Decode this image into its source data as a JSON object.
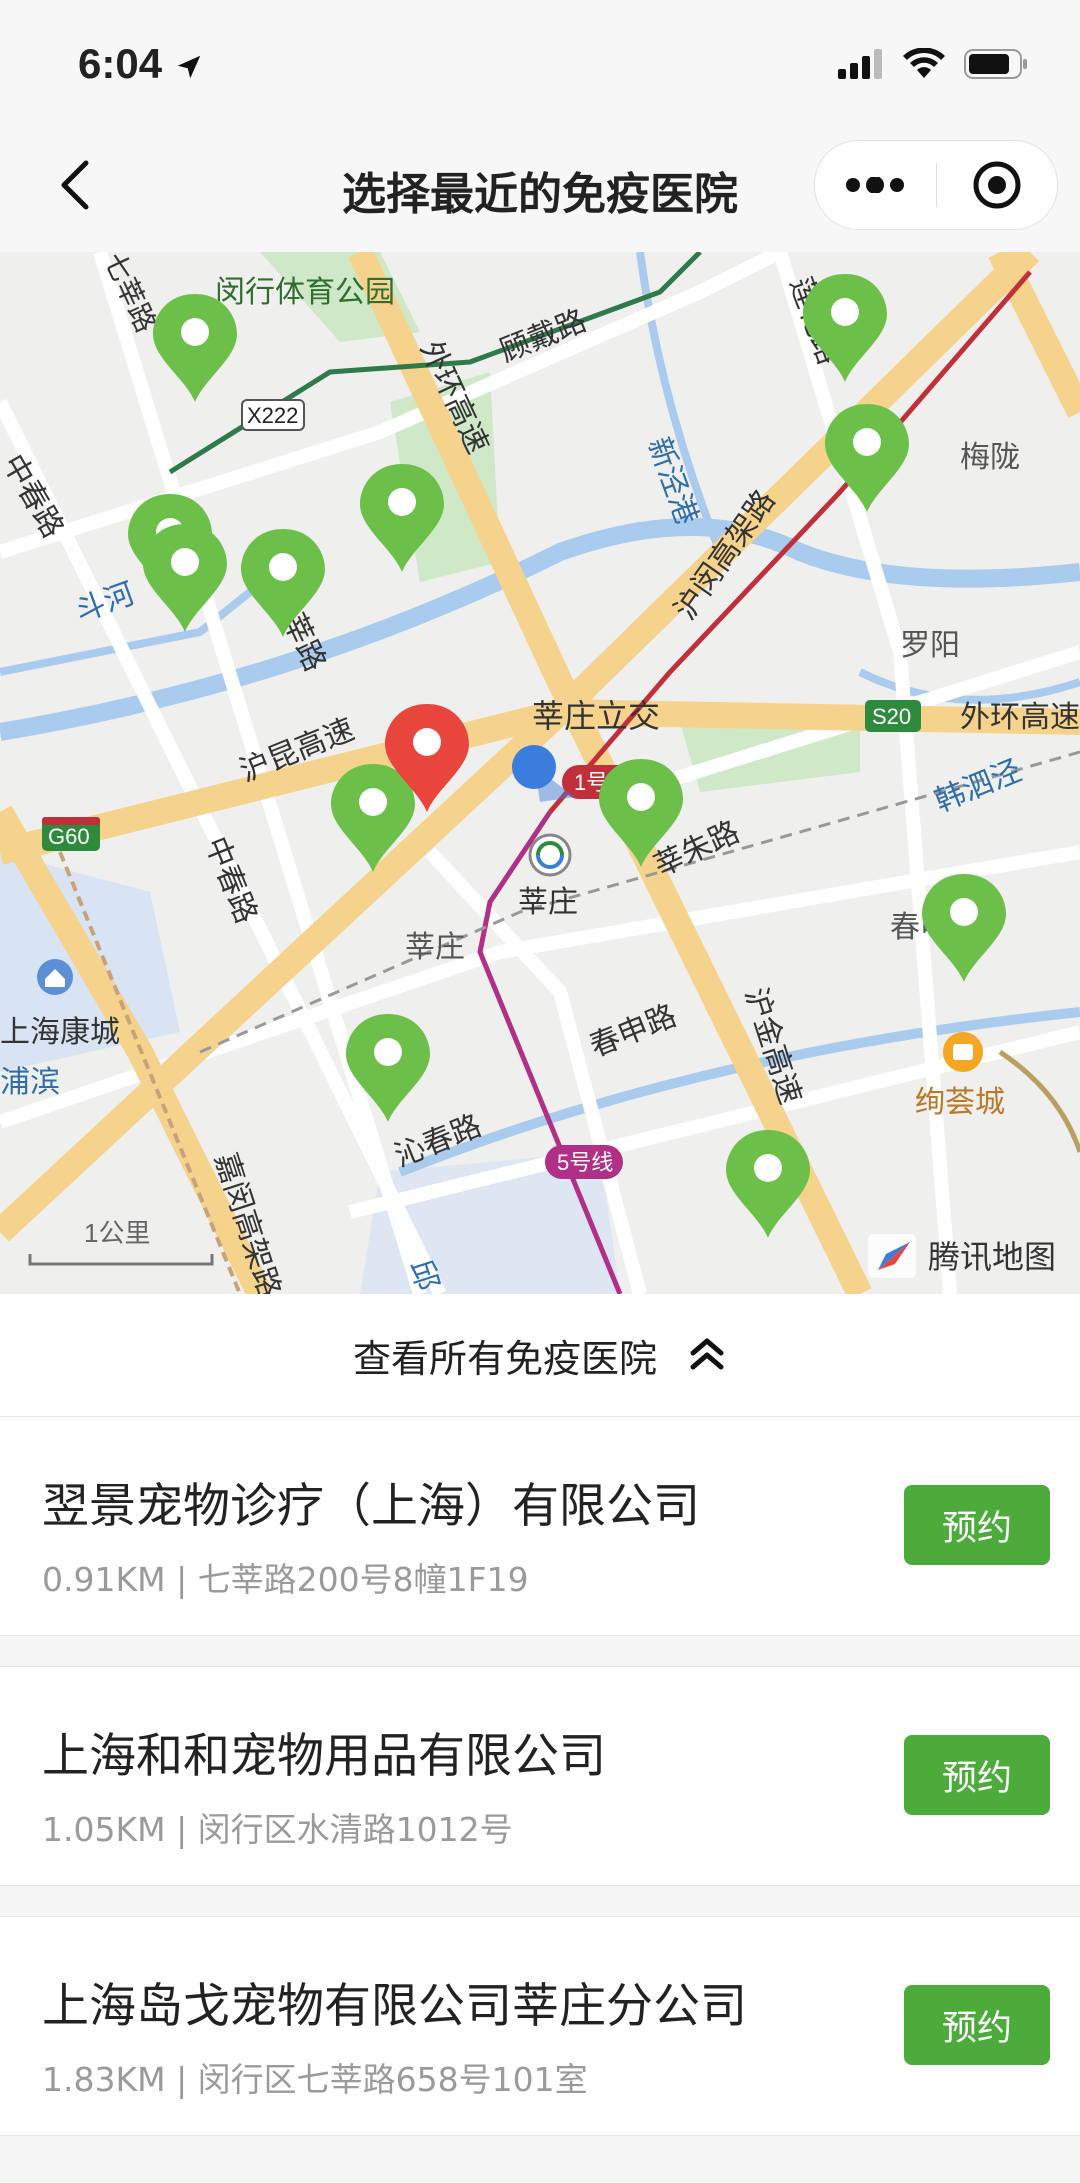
{
  "status": {
    "time": "6:04"
  },
  "nav": {
    "title": "选择最近的免疫医院"
  },
  "map": {
    "labels": {
      "park": "闵行体育公园",
      "qixin_road_n": "七莘路",
      "x222": "X222",
      "gudai_road": "顾戴路",
      "waihuan_expwy": "外环高速",
      "xinjing_harbor": "新泾港",
      "lianhua_road": "莲花路",
      "meilong": "梅陇",
      "zhongchun_road_n": "中春路",
      "douhe": "斗河",
      "qixin_road_mid": "七莘路",
      "hu_min_expwy_label": "沪闵高架路",
      "luoyang": "罗阳",
      "xinzhuang_interchange": "莘庄立交",
      "s20": "S20",
      "waihuan_expwy_e": "外环高速",
      "humin_expwy": "沪昆高速",
      "line1": "1号线",
      "hansi_jing": "韩泗泾",
      "g60": "G60",
      "zhongchun_road_s": "中春路",
      "xinzhuang_station": "莘庄",
      "xinzhu_road": "莘朱路",
      "chunshen": "春申",
      "xinzhuang_area": "莘庄",
      "kangcheng": "上海康城",
      "pubin": "浦滨",
      "hujin_expwy": "沪金高速",
      "chunshen_road": "春申路",
      "xuhui_city": "绚荟城",
      "qinchun_road": "沁春路",
      "line5": "5号线",
      "jiamin_expwy": "嘉闵高架路",
      "qiu": "邱",
      "scale": "1公里",
      "brand": "腾讯地图"
    }
  },
  "expand": {
    "label": "查看所有免疫医院"
  },
  "hospitals": [
    {
      "name": "翌景宠物诊疗（上海）有限公司",
      "info": "0.91KM | 七莘路200号8幢1F19",
      "button": "预约"
    },
    {
      "name": "上海和和宠物用品有限公司",
      "info": "1.05KM | 闵行区水清路1012号",
      "button": "预约"
    },
    {
      "name": "上海岛戈宠物有限公司莘庄分公司",
      "info": "1.83KM | 闵行区七莘路658号101室",
      "button": "预约"
    }
  ],
  "colors": {
    "accent": "#4dab3c",
    "pin_green": "#6cc04a",
    "pin_red": "#e8453c",
    "location_blue": "#3b7ddd"
  }
}
